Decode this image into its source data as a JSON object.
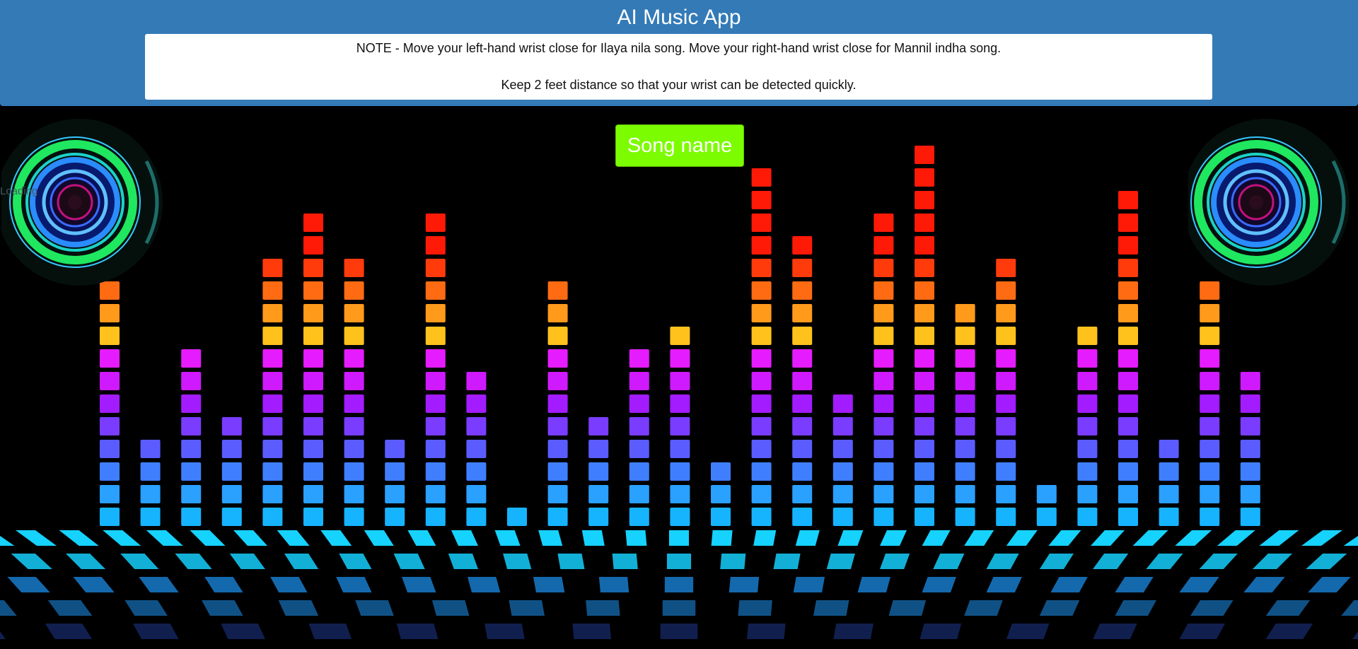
{
  "header": {
    "title": "AI Music App",
    "note_line1": "NOTE - Move your left-hand wrist close for Ilaya nila song. Move your right-hand wrist close for Mannil indha song.",
    "note_line2": "Keep 2 feet distance so that your wrist can be detected quickly.",
    "bg_color": "#337ab7"
  },
  "song_button": {
    "label": "Song name",
    "color": "#7cfc00"
  },
  "status": {
    "loading": "Loading"
  },
  "visualizer": {
    "bar_levels": [
      11,
      4,
      8,
      5,
      12,
      14,
      12,
      4,
      14,
      7,
      1,
      11,
      5,
      8,
      9,
      3,
      16,
      13,
      6,
      14,
      17,
      10,
      12,
      2,
      9,
      15,
      4,
      11,
      7
    ],
    "segment_colors": [
      "#16b4ff",
      "#2aa0ff",
      "#3f7fff",
      "#5b5cff",
      "#7a3cff",
      "#a21cff",
      "#cf1aff",
      "#e51cff",
      "#ffc21c",
      "#ff9a1a",
      "#ff6b12",
      "#ff3b0c",
      "#ff1a08"
    ],
    "speaker_colors": [
      "#1fe860",
      "#2a8cff",
      "#c3117c"
    ]
  }
}
